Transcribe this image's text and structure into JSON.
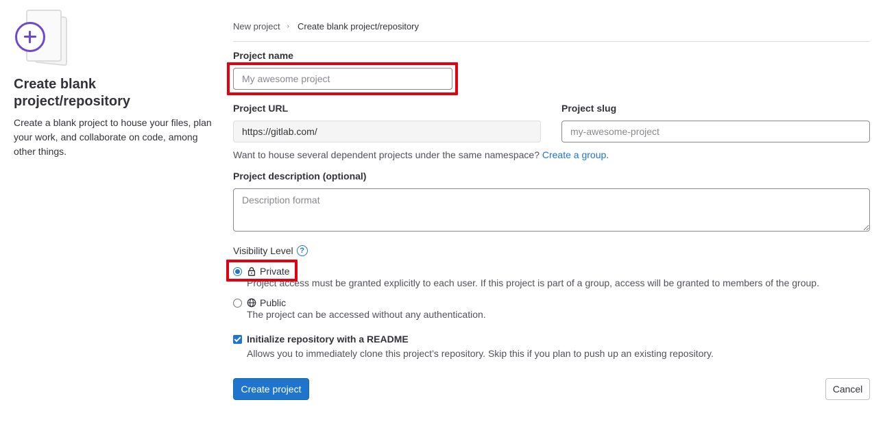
{
  "sidebar": {
    "title": "Create blank project/repository",
    "description": "Create a blank project to house your files, plan your work, and collaborate on code, among other things."
  },
  "breadcrumb": {
    "items": [
      "New project",
      "Create blank project/repository"
    ],
    "separator": "›"
  },
  "form": {
    "project_name": {
      "label": "Project name",
      "placeholder": "My awesome project",
      "value": ""
    },
    "project_url": {
      "label": "Project URL",
      "value": "https://gitlab.com/"
    },
    "project_slug": {
      "label": "Project slug",
      "placeholder": "my-awesome-project",
      "value": ""
    },
    "namespace_help": {
      "text": "Want to house several dependent projects under the same namespace?",
      "link": "Create a group",
      "suffix": "."
    },
    "description": {
      "label": "Project description (optional)",
      "placeholder": "Description format"
    },
    "visibility": {
      "label": "Visibility Level",
      "help_icon": "question-circle-icon",
      "options": [
        {
          "title": "Private",
          "icon": "lock-icon",
          "checked": true,
          "description": "Project access must be granted explicitly to each user. If this project is part of a group, access will be granted to members of the group."
        },
        {
          "title": "Public",
          "icon": "globe-icon",
          "checked": false,
          "description": "The project can be accessed without any authentication."
        }
      ]
    },
    "readme": {
      "label": "Initialize repository with a README",
      "checked": true,
      "description": "Allows you to immediately clone this project’s repository. Skip this if you plan to push up an existing repository."
    }
  },
  "buttons": {
    "create": "Create project",
    "cancel": "Cancel"
  },
  "colors": {
    "primary": "#1f75cb",
    "illustration_accent": "#6e49cb",
    "highlight": "#e3000f"
  }
}
